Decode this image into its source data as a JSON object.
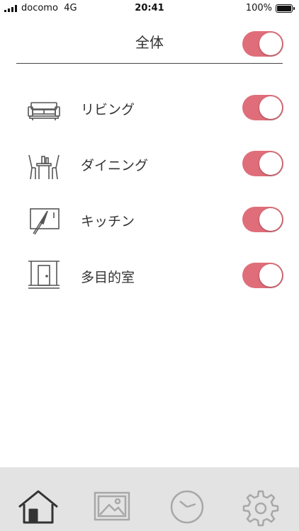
{
  "status_bar": {
    "carrier": "docomo",
    "network": "4G",
    "time": "20:41",
    "battery": "100%"
  },
  "header": {
    "title": "全体",
    "toggle_on": true
  },
  "rooms": [
    {
      "label": "リビング",
      "icon": "sofa-icon",
      "on": true
    },
    {
      "label": "ダイニング",
      "icon": "dining-table-icon",
      "on": true
    },
    {
      "label": "キッチン",
      "icon": "kitchen-knife-icon",
      "on": true
    },
    {
      "label": "多目的室",
      "icon": "door-room-icon",
      "on": true
    }
  ],
  "tabbar": [
    {
      "icon": "home-icon",
      "selected": true
    },
    {
      "icon": "image-icon",
      "selected": false
    },
    {
      "icon": "clock-icon",
      "selected": false
    },
    {
      "icon": "settings-gear-icon",
      "selected": false
    }
  ],
  "colors": {
    "toggle_on": "#e06e7a",
    "tabbar_bg": "#e3e3e3",
    "active_icon": "#333333",
    "inactive_icon": "#a8a8a8"
  }
}
